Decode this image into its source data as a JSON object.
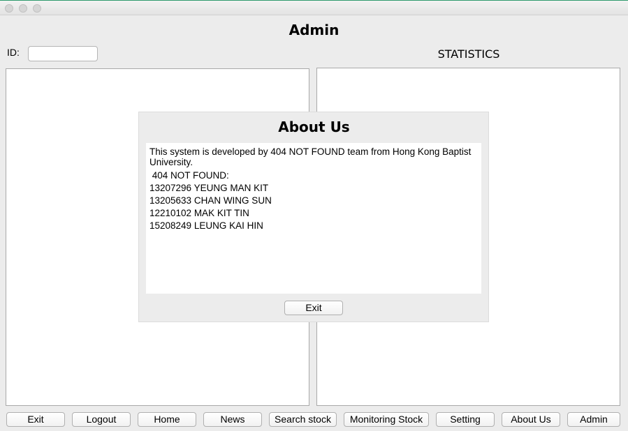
{
  "window": {
    "title": "Admin"
  },
  "id_field": {
    "label": "ID:",
    "value": ""
  },
  "statistics": {
    "title": "STATISTICS"
  },
  "dialog": {
    "title": "About Us",
    "intro": "This system is developed by 404 NOT FOUND team from Hong Kong Baptist University.",
    "team_label": " 404 NOT FOUND:",
    "members": [
      "13207296 YEUNG MAN KIT",
      "13205633 CHAN WING SUN",
      "12210102 MAK KIT TIN",
      "15208249 LEUNG KAI HIN"
    ],
    "exit_label": "Exit"
  },
  "nav": [
    {
      "id": "exit",
      "label": "Exit"
    },
    {
      "id": "logout",
      "label": "Logout"
    },
    {
      "id": "home",
      "label": "Home"
    },
    {
      "id": "news",
      "label": "News"
    },
    {
      "id": "search-stock",
      "label": "Search stock"
    },
    {
      "id": "monitoring-stock",
      "label": "Monitoring Stock"
    },
    {
      "id": "setting",
      "label": "Setting"
    },
    {
      "id": "about-us",
      "label": "About Us"
    },
    {
      "id": "admin",
      "label": "Admin"
    }
  ],
  "colors": {
    "window_bg": "#ececec",
    "panel_bg": "#ffffff",
    "titlebar_accent": "#2e9a6d"
  }
}
